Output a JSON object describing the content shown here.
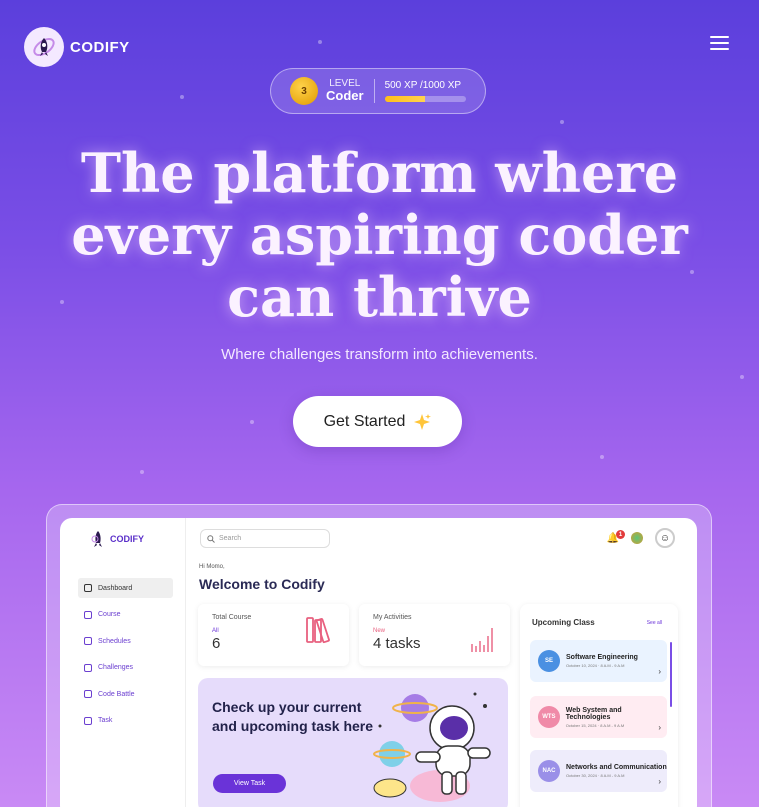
{
  "brand": {
    "name": "CODIFY"
  },
  "level": {
    "number": "3",
    "label": "LEVEL",
    "title": "Coder",
    "xp_text": "500 XP /1000 XP",
    "xp_progress": 0.5
  },
  "hero": {
    "line1": "The platform where",
    "line2": "every aspiring coder",
    "line3": "can thrive",
    "subtitle": "Where challenges transform into achievements.",
    "cta": "Get Started"
  },
  "dashboard": {
    "brand": "CODIFY",
    "search_placeholder": "Search",
    "notif_count": "1",
    "nav": [
      {
        "label": "Dashboard",
        "active": true
      },
      {
        "label": "Course"
      },
      {
        "label": "Schedules"
      },
      {
        "label": "Challenges"
      },
      {
        "label": "Code Battle"
      },
      {
        "label": "Task"
      }
    ],
    "greeting": "Hi Momo,",
    "welcome": "Welcome  to Codify",
    "total_course": {
      "title": "Total Course",
      "sub": "All",
      "value": "6"
    },
    "activities": {
      "title": "My Activities",
      "sub": "New",
      "value": "4 tasks"
    },
    "promo": {
      "text": "Check up your current and upcoming task here",
      "button": "View Task"
    },
    "upcoming": {
      "title": "Upcoming Class",
      "see_all": "See all",
      "classes": [
        {
          "badge": "SE",
          "name": "Software Engineering",
          "date": "October 10, 2024  ·  8 A.M - 9 A.M",
          "color": "#4a90e2",
          "bg": "#eaf3ff"
        },
        {
          "badge": "WTS",
          "name": "Web System and Technologies",
          "date": "October 15, 2024  ·  8 A.M - 9 A.M",
          "color": "#f08aa8",
          "bg": "#ffecf2"
        },
        {
          "badge": "NAC",
          "name": "Networks and Communication",
          "date": "October 30, 2024  ·  8 A.M - 9 A.M",
          "color": "#9a8fe8",
          "bg": "#eeecfb"
        }
      ]
    }
  }
}
